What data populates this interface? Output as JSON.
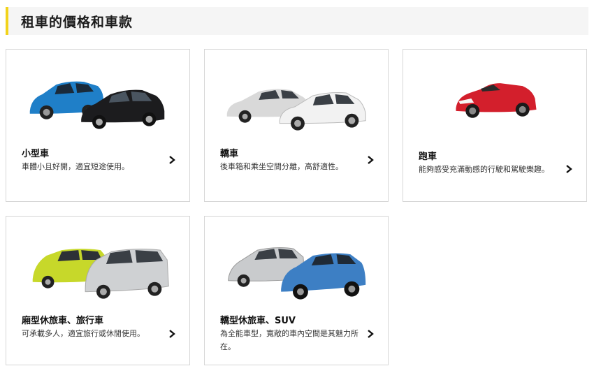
{
  "section_title": "租車的價格和車款",
  "cards": [
    {
      "title": "小型車",
      "desc": "車體小且好開，適宜短途使用。",
      "icon": "compact-cars-image"
    },
    {
      "title": "轎車",
      "desc": "後車箱和乘坐空間分離，高舒適性。",
      "icon": "sedan-cars-image"
    },
    {
      "title": "跑車",
      "desc": "能夠感受充滿動感的行駛和駕駛樂趣。",
      "icon": "sports-car-image"
    },
    {
      "title": "廂型休旅車、旅行車",
      "desc": "可承載多人，適宜旅行或休閒使用。",
      "icon": "minivan-image"
    },
    {
      "title": "轎型休旅車、SUV",
      "desc": "為全能車型，寬敞的車內空間是其魅力所在。",
      "icon": "suv-image"
    }
  ],
  "colors": {
    "accent": "#f2d31b",
    "card_border": "#d6d6d6",
    "header_bg": "#f5f5f5"
  }
}
